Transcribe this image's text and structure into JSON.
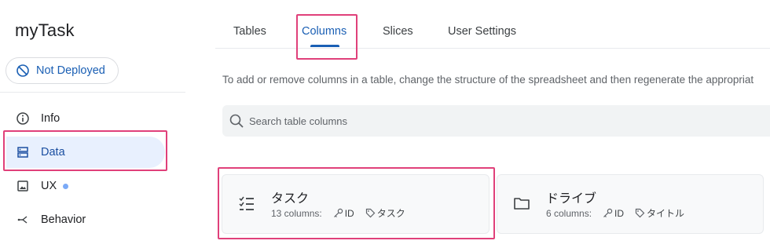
{
  "app": {
    "title": "myTask"
  },
  "deploy": {
    "label": "Not Deployed",
    "icon": "not-deployed-icon"
  },
  "sidebar": {
    "items": [
      {
        "label": "Info",
        "icon": "info-icon"
      },
      {
        "label": "Data",
        "icon": "data-icon",
        "active": true
      },
      {
        "label": "UX",
        "icon": "image-icon",
        "has_dot": true
      },
      {
        "label": "Behavior",
        "icon": "behavior-icon"
      }
    ]
  },
  "tabs": [
    {
      "label": "Tables"
    },
    {
      "label": "Columns",
      "active": true
    },
    {
      "label": "Slices"
    },
    {
      "label": "User Settings"
    }
  ],
  "description": "To add or remove columns in a table, change the structure of the spreadsheet and then regenerate the appropriat",
  "search": {
    "placeholder": "Search table columns"
  },
  "tables": [
    {
      "name": "タスク",
      "icon": "checklist-icon",
      "columns": "13 columns:",
      "key": "ID",
      "label": "タスク"
    },
    {
      "name": "ドライブ",
      "icon": "folder-icon",
      "columns": "6 columns:",
      "key": "ID",
      "label": "タイトル"
    }
  ],
  "colors": {
    "accent": "#1a5fb4",
    "highlight": "#e0407a",
    "active_bg": "#e8f0fe"
  }
}
